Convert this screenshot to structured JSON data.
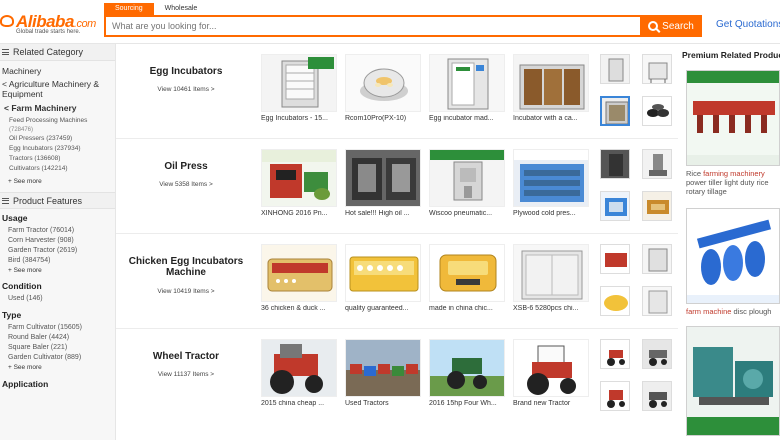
{
  "header": {
    "logo_word": "Alibaba",
    "logo_com": ".com",
    "logo_tagline": "Global trade starts here.",
    "search_tabs": [
      "Sourcing",
      "Wholesale"
    ],
    "search_placeholder": "What are you looking for...",
    "search_button": "Search",
    "quotations_link": "Get Quotations",
    "quotations_chevron": "›"
  },
  "sidebar": {
    "related_category": "Related Category",
    "cat_machinery": "Machinery",
    "cat_agri": "< Agriculture Machinery & Equipment",
    "cat_farm": "< Farm Machinery",
    "subcats": [
      {
        "name": "Feed Processing Machines",
        "count": "(728476)"
      },
      {
        "name": "Oil Pressers (237459)",
        "count": ""
      },
      {
        "name": "Egg Incubators (237934)",
        "count": ""
      },
      {
        "name": "Tractors (136608)",
        "count": ""
      },
      {
        "name": "Cultivators (142214)",
        "count": ""
      }
    ],
    "see_more": "+ See more",
    "product_features": "Product Features",
    "usage_title": "Usage",
    "usage_items": [
      "Farm Tractor (76014)",
      "Corn Harvester (908)",
      "Garden Tractor (2619)",
      "Bird (384754)"
    ],
    "usage_see_more": "+ See more",
    "condition_title": "Condition",
    "condition_items": [
      "Used (146)"
    ],
    "type_title": "Type",
    "type_items": [
      "Farm Cultivator (15605)",
      "Round Baler (4424)",
      "Square Baler (221)",
      "Garden Cultivator (889)"
    ],
    "type_see_more": "+ See more",
    "application_title": "Application"
  },
  "rows": [
    {
      "title": "Egg Incubators",
      "count": "View 10461 Items >",
      "products": [
        "Egg Incubators - 15...",
        "Rcom10Pro(PX-10)",
        "Egg incubator mad...",
        "Incubator with a ca..."
      ]
    },
    {
      "title": "Oil Press",
      "count": "View 5358 Items >",
      "products": [
        "XINHONG 2016 Pn...",
        "Hot sale!!! High oil ...",
        "Wiscoo pneumatic...",
        "Plywood cold pres..."
      ]
    },
    {
      "title": "Chicken Egg Incubators Machine",
      "count": "View 10419 Items >",
      "products": [
        "36 chicken & duck ...",
        "quality guaranteed...",
        "made in china chic...",
        "XSB-6 5280pcs chi..."
      ]
    },
    {
      "title": "Wheel Tractor",
      "count": "View 11137 Items >",
      "products": [
        "2015 china cheap ...",
        "Used Tractors",
        "2016 15hp Four Wh...",
        "Brand new Tractor"
      ]
    }
  ],
  "right": {
    "title": "Premium Related Products",
    "ads": [
      {
        "pre": "Rice ",
        "hl": "farming machinery",
        "post": " power tiller light duty rice rotary tillage"
      },
      {
        "pre": "",
        "hl": "farm machine",
        "post": " disc plough"
      },
      {
        "pre": "",
        "hl": "",
        "post": ""
      }
    ]
  },
  "colors": {
    "accent": "#ff6a00",
    "link": "#2a6ad1",
    "highlight": "#c0392b"
  }
}
